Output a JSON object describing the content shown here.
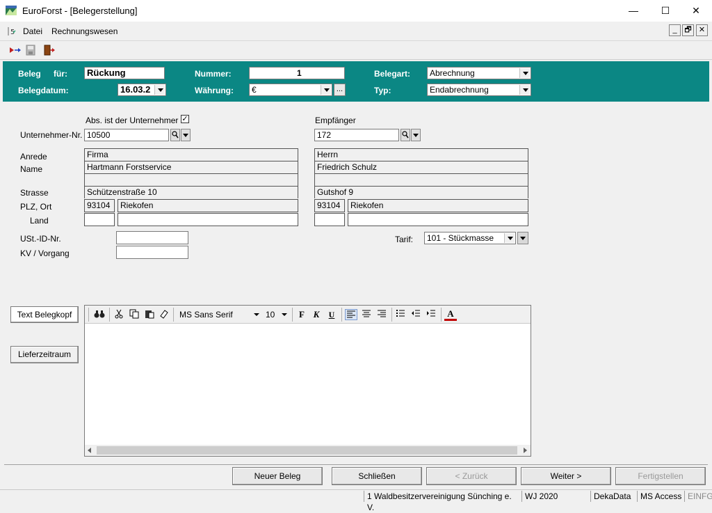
{
  "window": {
    "title": "EuroForst - [Belegerstellung]",
    "controls": {
      "minimize": "—",
      "maximize": "☐",
      "close": "✕"
    }
  },
  "menu": {
    "items": [
      {
        "label": "Datei"
      },
      {
        "label": "Rechnungswesen"
      }
    ],
    "mdi_controls": {
      "minimize": "_",
      "restore": "🗗",
      "close": "✕"
    }
  },
  "header": {
    "beleg_label": "Beleg",
    "fuer_label": "für:",
    "beleg_value": "Rückung",
    "belegdatum_label": "Belegdatum:",
    "belegdatum_value": "16.03.2",
    "nummer_label": "Nummer:",
    "nummer_value": "1",
    "waehrung_label": "Währung:",
    "waehrung_value": "€",
    "waehrung_btn": "...",
    "belegart_label": "Belegart:",
    "belegart_value": "Abrechnung",
    "typ_label": "Typ:",
    "typ_value": "Endabrechnung",
    "accent_color": "#0b8784"
  },
  "sender": {
    "abs_label": "Abs. ist der Unternehmer",
    "abs_checked": true,
    "checkmark": "✓",
    "unternehmer_nr_label": "Unternehmer-Nr.",
    "unternehmer_nr": "10500",
    "anrede_label": "Anrede",
    "name_label": "Name",
    "strasse_label": "Strasse",
    "plz_ort_label": "PLZ, Ort",
    "land_label": "Land",
    "anrede": "Firma",
    "name": "Hartmann Forstservice",
    "name2": "",
    "strasse": "Schützenstraße 10",
    "plz": "93104",
    "ort": "Riekofen",
    "land": "",
    "land2": "",
    "ust_label": "USt.-ID-Nr.",
    "ust_value": "",
    "kv_label": "KV / Vorgang",
    "kv_value": ""
  },
  "recipient": {
    "label": "Empfänger",
    "nr": "172",
    "anrede": "Herrn",
    "name": "Friedrich Schulz",
    "name2": "",
    "strasse": "Gutshof 9",
    "plz": "93104",
    "ort": "Riekofen",
    "land": "",
    "land2": "",
    "tarif_label": "Tarif:",
    "tarif_value": "101 - Stückmasse"
  },
  "side_buttons": {
    "text_belegkopf": "Text Belegkopf",
    "lieferzeitraum": "Lieferzeitraum"
  },
  "editor": {
    "font": "MS Sans Serif",
    "size": "10",
    "bold": "F",
    "italic": "K",
    "underline": "U",
    "font_color": "A",
    "content": ""
  },
  "footer_buttons": {
    "neuer_beleg": "Neuer Beleg",
    "schliessen": "Schließen",
    "zurueck": "< Zurück",
    "weiter": "Weiter >",
    "fertigstellen": "Fertigstellen"
  },
  "statusbar": {
    "org": "1 Waldbesitzervereinigung Sünching e. V.",
    "wj": "WJ 2020",
    "db": "DekaData",
    "access": "MS Access",
    "mode": "EINFG"
  }
}
